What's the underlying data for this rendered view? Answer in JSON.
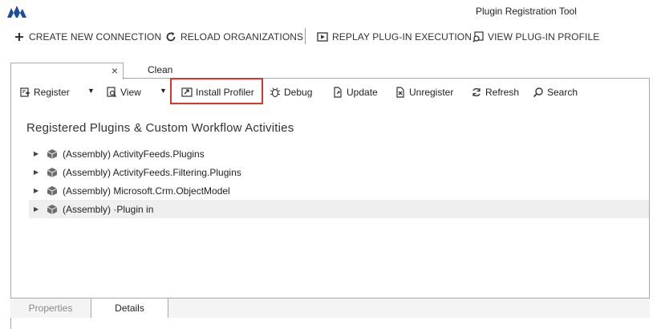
{
  "window": {
    "title": "Plugin Registration Tool"
  },
  "main_toolbar": {
    "create_connection": "CREATE NEW CONNECTION",
    "reload_organizations": "RELOAD ORGANIZATIONS",
    "replay_execution": "REPLAY PLUG-IN EXECUTION",
    "view_profile": "VIEW PLUG-IN PROFILE"
  },
  "tabs": {
    "first_close": "×",
    "second_label": "Clean"
  },
  "sub_toolbar": {
    "register": "Register",
    "view": "View",
    "install_profiler": "Install Profiler",
    "debug": "Debug",
    "update": "Update",
    "unregister": "Unregister",
    "refresh": "Refresh",
    "search": "Search"
  },
  "section": {
    "title": "Registered Plugins & Custom Workflow Activities"
  },
  "tree": [
    {
      "label": "(Assembly) ActivityFeeds.Plugins"
    },
    {
      "label": "(Assembly) ActivityFeeds.Filtering.Plugins"
    },
    {
      "label": "(Assembly) Microsoft.Crm.ObjectModel"
    },
    {
      "label": "(Assembly) ·Plugin in"
    }
  ],
  "bottom_tabs": {
    "properties": "Properties",
    "details": "Details"
  },
  "colors": {
    "highlight": "#d9372b",
    "selected_row": "#efefef",
    "logo": "#1b4e9b"
  }
}
